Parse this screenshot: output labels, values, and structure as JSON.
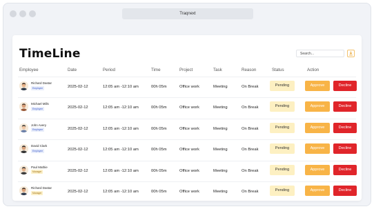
{
  "browser": {
    "url_title": "Traqnext"
  },
  "page": {
    "title": "TimeLine",
    "search_placeholder": "Search...",
    "download_icon": "download-icon"
  },
  "columns": [
    "Employee",
    "Date",
    "Period",
    "Time",
    "Project",
    "Task",
    "Reason",
    "Status",
    "Action"
  ],
  "rows": [
    {
      "name": "Richard Dastar",
      "role": "Employee",
      "role_kind": "employee",
      "date": "2025-02-12",
      "period": "12:05 am -12:10 am",
      "time": "00h 05m",
      "project": "Office work",
      "task": "Meeting",
      "reason": "On Break",
      "status": "Pending",
      "approve": "Approve",
      "decline": "Decline"
    },
    {
      "name": "Michael Mills",
      "role": "Employee",
      "role_kind": "employee",
      "date": "2025-02-12",
      "period": "12:05 am -12:10 am",
      "time": "00h 05m",
      "project": "Office work",
      "task": "Meeting",
      "reason": "On Break",
      "status": "Pending",
      "approve": "Approve",
      "decline": "Decline"
    },
    {
      "name": "John Avery",
      "role": "Employee",
      "role_kind": "employee",
      "date": "2025-02-12",
      "period": "12:05 am -12:10 am",
      "time": "00h 05m",
      "project": "Office work",
      "task": "Meeting",
      "reason": "On Break",
      "status": "Pending",
      "approve": "Approve",
      "decline": "Decline"
    },
    {
      "name": "David Clark",
      "role": "Employee",
      "role_kind": "employee",
      "date": "2025-02-12",
      "period": "12:05 am -12:10 am",
      "time": "00h 05m",
      "project": "Office work",
      "task": "Meeting",
      "reason": "On Break",
      "status": "Pending",
      "approve": "Approve",
      "decline": "Decline"
    },
    {
      "name": "Paul Mathie",
      "role": "Manager",
      "role_kind": "manager",
      "date": "2025-02-12",
      "period": "12:05 am -12:10 am",
      "time": "00h 05m",
      "project": "Office work",
      "task": "Meeting",
      "reason": "On Break",
      "status": "Pending",
      "approve": "Approve",
      "decline": "Decline"
    },
    {
      "name": "Richard Dastar",
      "role": "Manager",
      "role_kind": "manager",
      "date": "2025-02-12",
      "period": "12:05 am -12:10 am",
      "time": "00h 05m",
      "project": "Office work",
      "task": "Meeting",
      "reason": "On Break",
      "status": "Pending",
      "approve": "Approve",
      "decline": "Decline"
    }
  ],
  "colors": {
    "accent": "#f8b447",
    "danger": "#e0252a",
    "pending_bg": "#fdf0c2"
  }
}
